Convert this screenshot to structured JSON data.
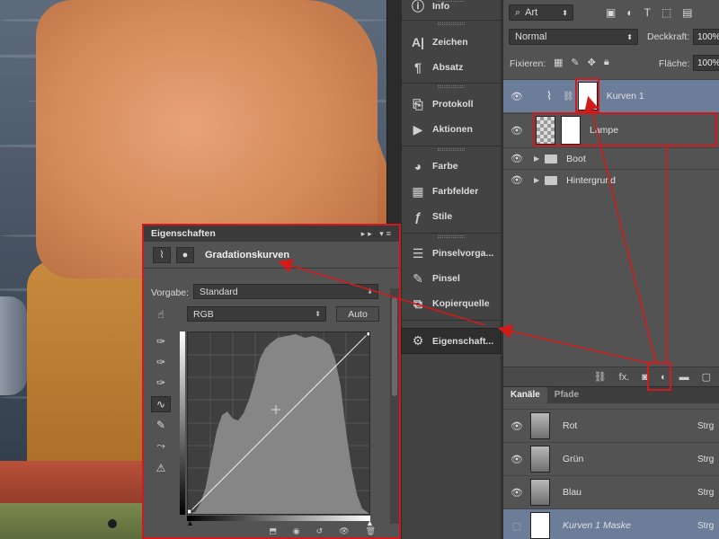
{
  "dock": {
    "items": [
      {
        "label": "Info",
        "icon": "info-icon"
      },
      {
        "label": "Zeichen",
        "icon": "character-icon"
      },
      {
        "label": "Absatz",
        "icon": "paragraph-icon"
      },
      {
        "label": "Protokoll",
        "icon": "history-icon"
      },
      {
        "label": "Aktionen",
        "icon": "actions-icon"
      },
      {
        "label": "Farbe",
        "icon": "color-icon"
      },
      {
        "label": "Farbfelder",
        "icon": "swatches-icon"
      },
      {
        "label": "Stile",
        "icon": "styles-icon"
      },
      {
        "label": "Pinselvorga...",
        "icon": "brush-presets-icon"
      },
      {
        "label": "Pinsel",
        "icon": "brush-icon"
      },
      {
        "label": "Kopierquelle",
        "icon": "clone-source-icon"
      },
      {
        "label": "Eigenschaft...",
        "icon": "properties-icon"
      }
    ]
  },
  "layers": {
    "filter": "Art",
    "blend_mode": "Normal",
    "opacity_label": "Deckkraft:",
    "opacity_value": "100%",
    "lock_label": "Fixieren:",
    "fill_label": "Fläche:",
    "fill_value": "100%",
    "rows": [
      {
        "name": "Kurven 1",
        "selected": true
      },
      {
        "name": "Lampe"
      },
      {
        "name": "Boot",
        "type": "folder"
      },
      {
        "name": "Hintergrund",
        "type": "folder"
      }
    ],
    "footer_fx": "fx."
  },
  "channels": {
    "tabs": [
      "Kanäle",
      "Pfade"
    ],
    "rows": [
      {
        "name": "Rot",
        "shortcut": "Strg"
      },
      {
        "name": "Grün",
        "shortcut": "Strg"
      },
      {
        "name": "Blau",
        "shortcut": "Strg"
      },
      {
        "name": "Kurven 1 Maske",
        "shortcut": "Strg"
      }
    ]
  },
  "properties": {
    "title": "Eigenschaften",
    "adjustment_type": "Gradationskurven",
    "preset_label": "Vorgabe:",
    "preset_value": "Standard",
    "channel_value": "RGB",
    "auto_label": "Auto"
  },
  "colors": {
    "highlight": "#d11b1b",
    "panel_bg": "#535353",
    "selected_row": "#6b7d99"
  }
}
